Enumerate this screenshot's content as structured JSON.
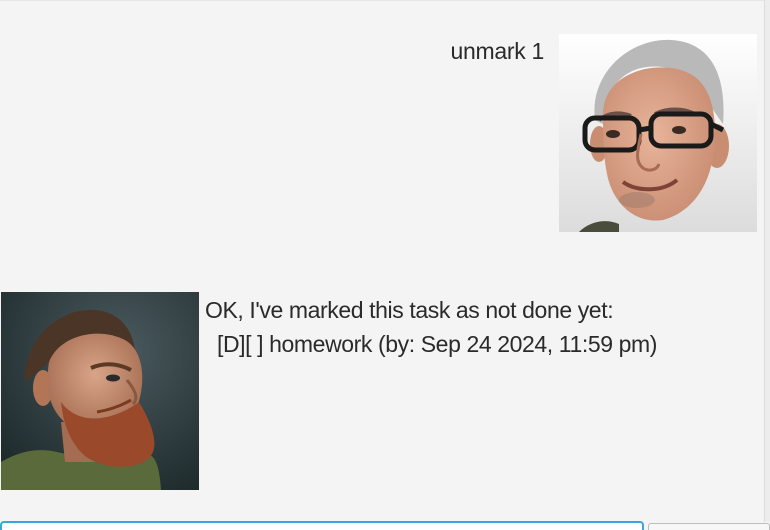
{
  "dialog": [
    {
      "sender": "user",
      "text": "unmark 1",
      "avatar_icon": "user-portrait-icon"
    },
    {
      "sender": "bot",
      "text": "OK, I've marked this task as not done yet:\n  [D][ ] homework (by: Sep 24 2024, 11:59 pm)",
      "avatar_icon": "bot-portrait-icon"
    }
  ],
  "input": {
    "value": ""
  },
  "colors": {
    "background": "#f4f4f4",
    "input_focus_border": "#3aa6dd"
  }
}
